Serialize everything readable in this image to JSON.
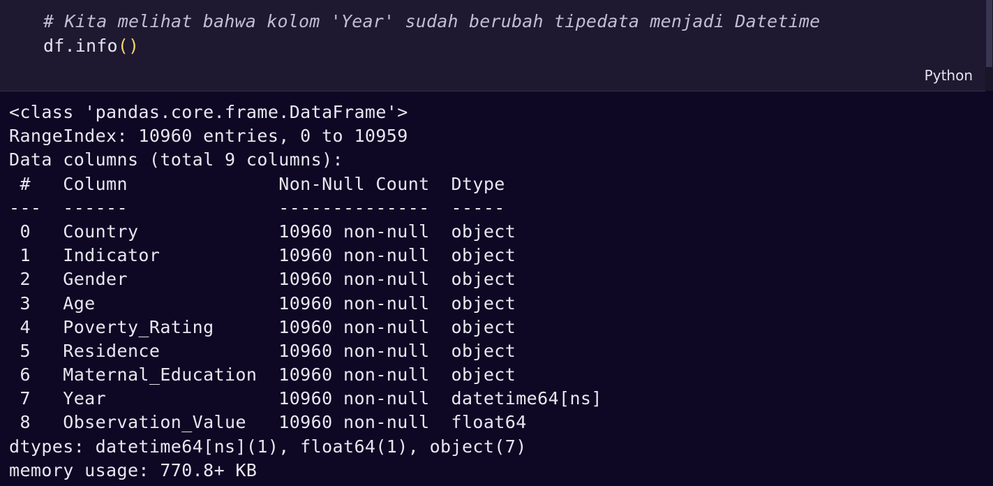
{
  "cell": {
    "comment": "# Kita melihat bahwa kolom 'Year' sudah berubah tipedata menjadi Datetime",
    "code_prefix": "df.info",
    "code_open_paren": "(",
    "code_close_paren": ")",
    "language": "Python"
  },
  "output": {
    "lines": [
      "<class 'pandas.core.frame.DataFrame'>",
      "RangeIndex: 10960 entries, 0 to 10959",
      "Data columns (total 9 columns):",
      " #   Column              Non-Null Count  Dtype",
      "---  ------              --------------  -----",
      " 0   Country             10960 non-null  object",
      " 1   Indicator           10960 non-null  object",
      " 2   Gender              10960 non-null  object",
      " 3   Age                 10960 non-null  object",
      " 4   Poverty_Rating      10960 non-null  object",
      " 5   Residence           10960 non-null  object",
      " 6   Maternal_Education  10960 non-null  object",
      " 7   Year                10960 non-null  datetime64[ns]",
      " 8   Observation_Value   10960 non-null  float64",
      "dtypes: datetime64[ns](1), float64(1), object(7)",
      "memory usage: 770.8+ KB"
    ]
  }
}
